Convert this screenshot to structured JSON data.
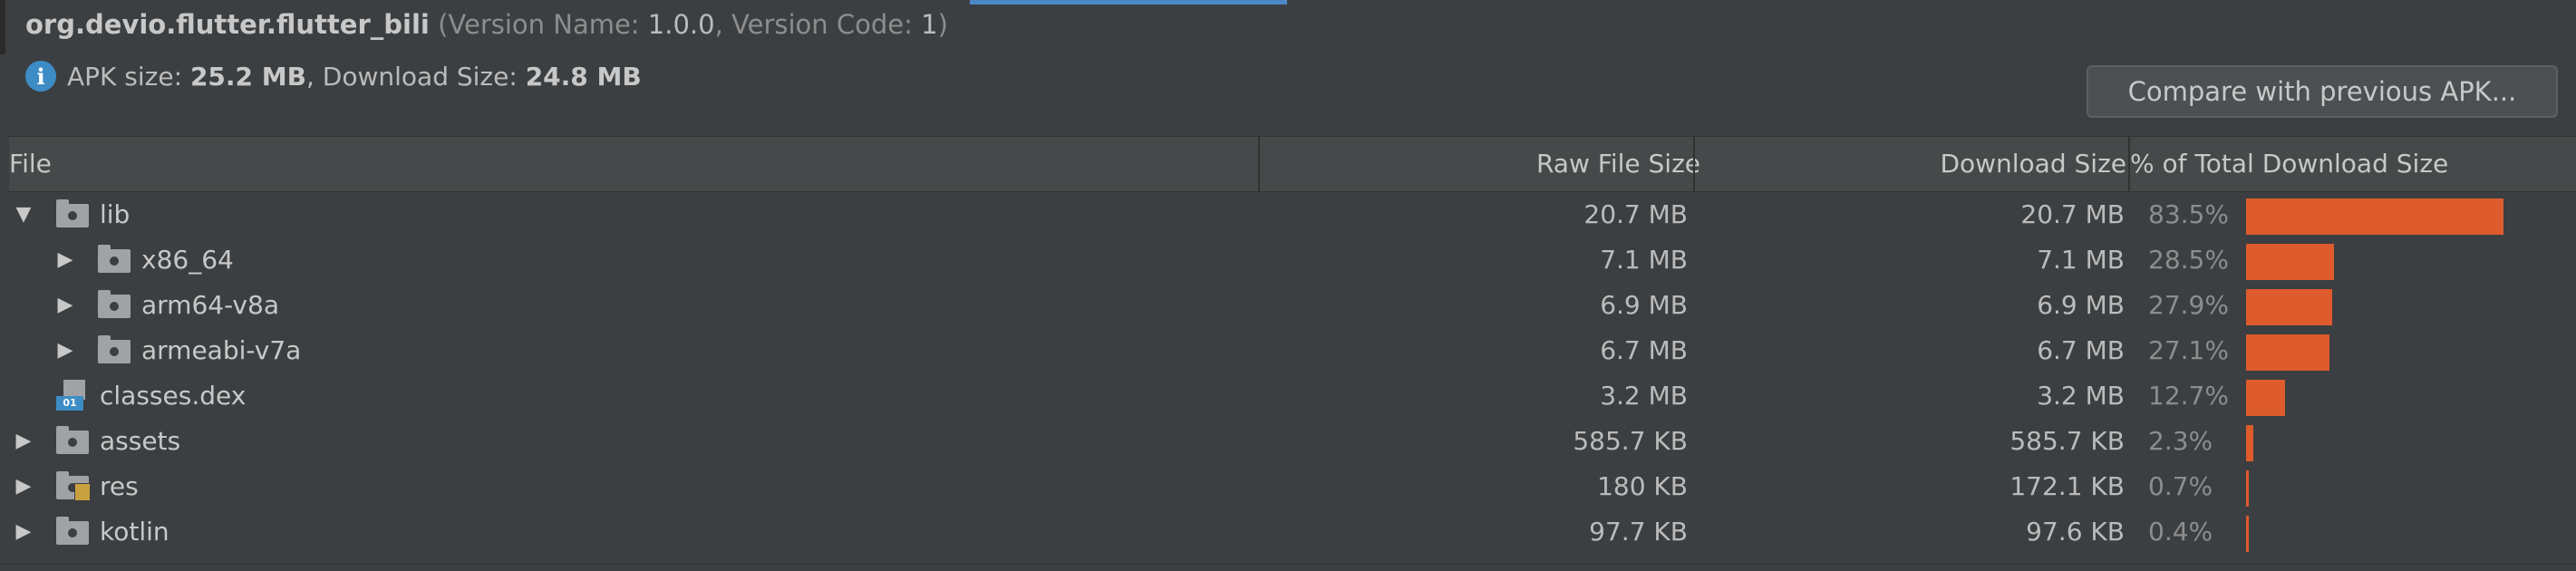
{
  "header": {
    "package": "org.devio.flutter.flutter_bili",
    "version_name_label": "(Version Name: ",
    "version_name": "1.0.0",
    "version_code_label": ", Version Code: ",
    "version_code": "1",
    "close_paren": ")"
  },
  "sizes": {
    "apk_label": "APK size: ",
    "apk_value": "25.2 MB",
    "download_label": ", Download Size: ",
    "download_value": "24.8 MB"
  },
  "compare_button": "Compare with previous APK...",
  "columns": {
    "file": "File",
    "raw": "Raw File Size",
    "download": "Download Size",
    "percent": "% of Total Download Size"
  },
  "rows": [
    {
      "name": "lib",
      "raw": "20.7 MB",
      "download": "20.7 MB",
      "percent": "83.5%",
      "fraction": 0.835,
      "icon": "folder-icon",
      "expander": "expanded",
      "depth": 0
    },
    {
      "name": "x86_64",
      "raw": "7.1 MB",
      "download": "7.1 MB",
      "percent": "28.5%",
      "fraction": 0.285,
      "icon": "folder-icon",
      "expander": "collapsed",
      "depth": 1
    },
    {
      "name": "arm64-v8a",
      "raw": "6.9 MB",
      "download": "6.9 MB",
      "percent": "27.9%",
      "fraction": 0.279,
      "icon": "folder-icon",
      "expander": "collapsed",
      "depth": 1
    },
    {
      "name": "armeabi-v7a",
      "raw": "6.7 MB",
      "download": "6.7 MB",
      "percent": "27.1%",
      "fraction": 0.271,
      "icon": "folder-icon",
      "expander": "collapsed",
      "depth": 1
    },
    {
      "name": "classes.dex",
      "raw": "3.2 MB",
      "download": "3.2 MB",
      "percent": "12.7%",
      "fraction": 0.127,
      "icon": "dex-file-icon",
      "expander": "none",
      "depth": 0
    },
    {
      "name": "assets",
      "raw": "585.7 KB",
      "download": "585.7 KB",
      "percent": "2.3%",
      "fraction": 0.023,
      "icon": "folder-icon",
      "expander": "collapsed",
      "depth": 0
    },
    {
      "name": "res",
      "raw": "180 KB",
      "download": "172.1 KB",
      "percent": "0.7%",
      "fraction": 0.007,
      "icon": "resource-folder-icon",
      "expander": "collapsed",
      "depth": 0
    },
    {
      "name": "kotlin",
      "raw": "97.7 KB",
      "download": "97.6 KB",
      "percent": "0.4%",
      "fraction": 0.004,
      "icon": "folder-icon",
      "expander": "collapsed",
      "depth": 0
    }
  ],
  "icons": {
    "dex_badge": "01"
  },
  "colors": {
    "background": "#3c3f41",
    "bar": "#dd5b2c",
    "info": "#3d8cc6",
    "tab_indicator": "#4a88c7"
  }
}
